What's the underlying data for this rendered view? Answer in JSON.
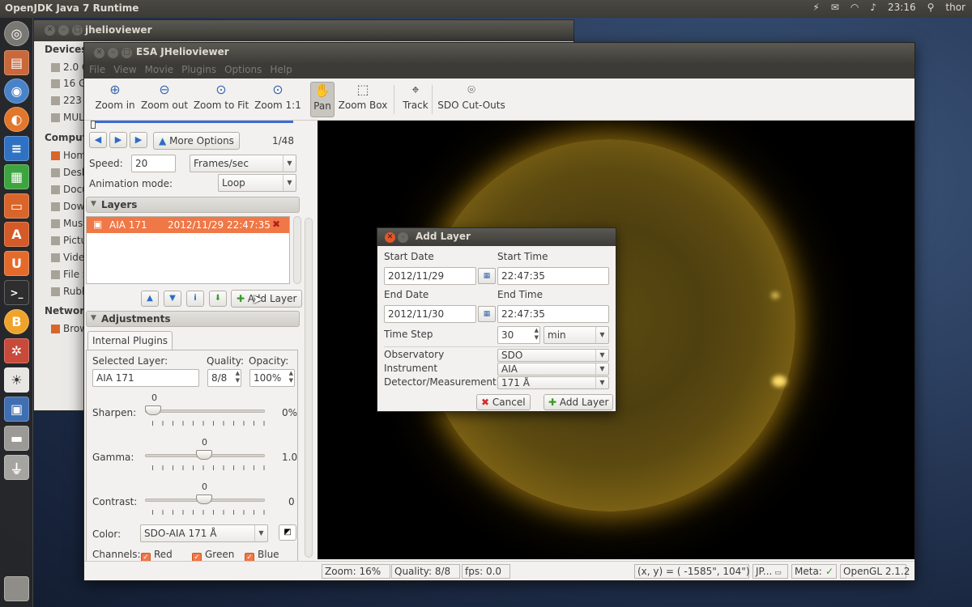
{
  "top_panel": {
    "app_title": "OpenJDK Java 7 Runtime",
    "time": "23:16",
    "user": "thor"
  },
  "launcher": {
    "icons": [
      "ubuntu-logo-icon",
      "files-icon",
      "chromium-icon",
      "firefox-icon",
      "writer-icon",
      "calc-icon",
      "impress-icon",
      "software-center-icon",
      "ubuntu-one-icon",
      "terminal-icon",
      "bitcoin-icon",
      "system-settings-icon",
      "jhelioviewer-icon",
      "workspace-switcher-icon",
      "drive-icon",
      "usb-drive-icon",
      "trash-icon"
    ]
  },
  "back_window": {
    "title": "jhelioviewer",
    "devices_heading": "Devices",
    "devices": [
      "2.0 G",
      "16 G",
      "223 G",
      "MUL"
    ],
    "computer_heading": "Comput",
    "computer_items": [
      "Hom",
      "Desk",
      "Docu",
      "Dow",
      "Mus",
      "Pictu",
      "Vide",
      "File S",
      "Rubb"
    ],
    "network_heading": "Network",
    "network_items": [
      "Brow"
    ]
  },
  "main_window": {
    "title": "ESA JHelioviewer",
    "menu": [
      "File",
      "View",
      "Movie",
      "Plugins",
      "Options",
      "Help"
    ]
  },
  "toolbar": {
    "zoom_in": "Zoom in",
    "zoom_out": "Zoom out",
    "zoom_fit": "Zoom to Fit",
    "zoom_1_1": "Zoom 1:1",
    "pan": "Pan",
    "zoom_box": "Zoom Box",
    "track": "Track",
    "sdo_cutouts": "SDO Cut-Outs"
  },
  "movie_controls": {
    "more_options": "More Options",
    "frame_counter": "1/48",
    "speed_label": "Speed:",
    "speed_value": "20",
    "speed_unit": "Frames/sec",
    "animation_mode_label": "Animation mode:",
    "animation_mode_value": "Loop",
    "progress_fraction": 0.02
  },
  "layers": {
    "heading": "Layers",
    "items": [
      {
        "name": "AIA 171",
        "timestamp": "2012/11/29 22:47:35"
      }
    ],
    "add_layer_button": "Add Layer"
  },
  "adjustments": {
    "heading": "Adjustments",
    "tab": "Internal Plugins",
    "selected_layer_label": "Selected Layer:",
    "selected_layer_value": "AIA 171",
    "quality_label": "Quality:",
    "quality_value": "8/8",
    "opacity_label": "Opacity:",
    "opacity_value": "100%",
    "sharpen_label": "Sharpen:",
    "sharpen_top": "0",
    "sharpen_value": "0%",
    "gamma_label": "Gamma:",
    "gamma_top": "0",
    "gamma_value": "1.0",
    "contrast_label": "Contrast:",
    "contrast_top": "0",
    "contrast_value": "0",
    "color_label": "Color:",
    "color_value": "SDO-AIA 171 Å",
    "channels_label": "Channels:",
    "channel_red": "Red",
    "channel_green": "Green",
    "channel_blue": "Blue"
  },
  "status_bar": {
    "zoom": "Zoom: 16%",
    "quality": "Quality: 8/8",
    "fps": "fps: 0.0",
    "coords": "(x, y) = ( -1585\",  104\")",
    "jp": "JP...",
    "meta": "Meta:",
    "opengl": "OpenGL 2.1.2"
  },
  "add_layer_dialog": {
    "title": "Add Layer",
    "start_date_label": "Start Date",
    "start_date": "2012/11/29",
    "start_time_label": "Start Time",
    "start_time": "22:47:35",
    "end_date_label": "End Date",
    "end_date": "2012/11/30",
    "end_time_label": "End Time",
    "end_time": "22:47:35",
    "time_step_label": "Time Step",
    "time_step_value": "30",
    "time_step_unit": "min",
    "observatory_label": "Observatory",
    "observatory_value": "SDO",
    "instrument_label": "Instrument",
    "instrument_value": "AIA",
    "detector_label": "Detector/Measurement",
    "detector_value": "171 Å",
    "cancel_button": "Cancel",
    "add_button": "Add Layer"
  }
}
